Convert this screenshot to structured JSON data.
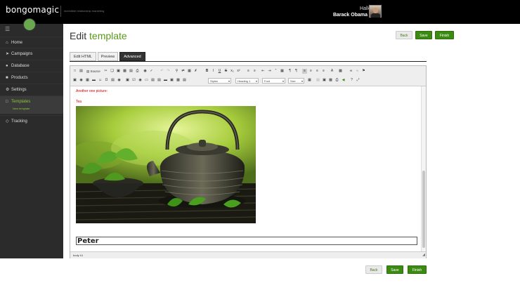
{
  "header": {
    "logo": "bongomagic",
    "tagline": "incredible relationship marketing",
    "greeting": "Hallo",
    "user_name": "Barack Obama"
  },
  "sidebar": {
    "items": [
      {
        "label": "Home",
        "icon": "home-icon"
      },
      {
        "label": "Campaigns",
        "icon": "paper-plane-icon"
      },
      {
        "label": "Database",
        "icon": "users-icon"
      },
      {
        "label": "Products",
        "icon": "box-icon"
      },
      {
        "label": "Settings",
        "icon": "gear-icon"
      },
      {
        "label": "Templates",
        "icon": "document-icon",
        "sub": "New template"
      },
      {
        "label": "Tracking",
        "icon": "diamond-icon"
      }
    ]
  },
  "page": {
    "title_prefix": "Edit ",
    "title_accent": "template"
  },
  "buttons": {
    "back": "Back",
    "save": "Save",
    "finish": "Finish"
  },
  "tabs": [
    {
      "label": "Edit HTML"
    },
    {
      "label": "Preview"
    },
    {
      "label": "Advanced"
    }
  ],
  "toolbar": {
    "source": "Source",
    "styles": "Styles",
    "heading": "Heading 1",
    "font": "Font",
    "size": "Size"
  },
  "content": {
    "line1": "Another one picture:",
    "line2": "Tea",
    "name_field": "Peter"
  },
  "statusbar": {
    "path": "body  h1"
  },
  "colors": {
    "accent_green": "#3b8a12",
    "title_green": "#5a9a1a",
    "red_text": "#cc0000",
    "topbar": "#000000",
    "sidebar": "#2b2b2b"
  }
}
